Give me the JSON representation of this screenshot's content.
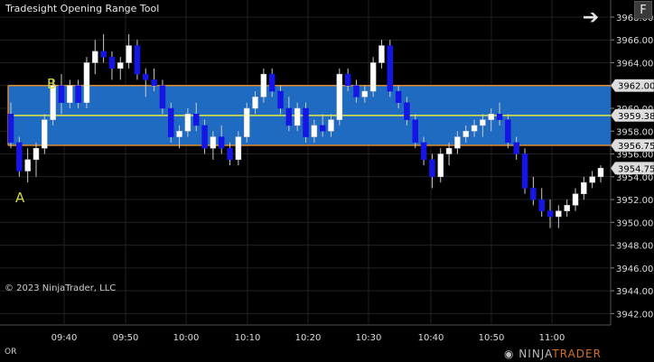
{
  "window": {
    "title": "Tradesight Opening Range Tool",
    "f_label": "F",
    "arrow_icon": "arrow-right-icon"
  },
  "labels": {
    "a": "A",
    "b": "B"
  },
  "footer": {
    "copyright": "© 2023 NinjaTrader, LLC",
    "indicator_short": "OR",
    "logo_part1": "NINJA",
    "logo_part2": "TRADER"
  },
  "colors": {
    "range_fill": "#1f6bc2",
    "range_border": "#e0892b",
    "mid_line": "#e9e93c",
    "up_candle": "#ffffff",
    "down_candle": "#1515e6",
    "grid": "#222"
  },
  "chart_data": {
    "type": "candlestick",
    "y_ticks": [
      "3968.00",
      "3966.00",
      "3964.00",
      "3962.00",
      "3960.00",
      "3958.00",
      "3956.00",
      "3954.00",
      "3952.00",
      "3950.00",
      "3948.00",
      "3946.00",
      "3944.00",
      "3942.00"
    ],
    "x_ticks": [
      "09:40",
      "09:50",
      "10:00",
      "10:10",
      "10:20",
      "10:30",
      "10:40",
      "10:50",
      "11:00"
    ],
    "opening_range": {
      "high": "3962.00",
      "low": "3956.75",
      "mid": "3959.38"
    },
    "last_price": "3954.75",
    "ylim": [
      3941.0,
      3969.5
    ],
    "candles": [
      [
        3959.5,
        3960.5,
        3956.5,
        3957.0
      ],
      [
        3957.0,
        3957.5,
        3954.0,
        3954.5
      ],
      [
        3954.5,
        3956.5,
        3953.5,
        3955.5
      ],
      [
        3955.5,
        3957.0,
        3954.0,
        3956.5
      ],
      [
        3956.5,
        3959.5,
        3956.0,
        3959.0
      ],
      [
        3959.0,
        3962.5,
        3958.5,
        3962.0
      ],
      [
        3962.0,
        3963.0,
        3959.5,
        3960.5
      ],
      [
        3960.5,
        3962.5,
        3960.0,
        3962.0
      ],
      [
        3962.0,
        3962.5,
        3960.0,
        3960.5
      ],
      [
        3960.5,
        3964.5,
        3960.0,
        3964.0
      ],
      [
        3964.0,
        3966.0,
        3963.0,
        3965.0
      ],
      [
        3965.0,
        3966.5,
        3964.0,
        3964.5
      ],
      [
        3964.5,
        3965.0,
        3962.5,
        3963.5
      ],
      [
        3963.5,
        3964.5,
        3962.5,
        3964.0
      ],
      [
        3964.0,
        3966.5,
        3963.5,
        3965.5
      ],
      [
        3965.5,
        3966.0,
        3962.5,
        3963.0
      ],
      [
        3963.0,
        3963.5,
        3961.0,
        3962.5
      ],
      [
        3962.5,
        3963.5,
        3961.5,
        3962.0
      ],
      [
        3962.0,
        3962.5,
        3959.5,
        3960.0
      ],
      [
        3960.0,
        3960.5,
        3957.0,
        3957.5
      ],
      [
        3957.5,
        3958.5,
        3956.5,
        3958.0
      ],
      [
        3958.0,
        3960.0,
        3957.5,
        3959.5
      ],
      [
        3959.5,
        3960.5,
        3958.0,
        3958.5
      ],
      [
        3958.5,
        3959.0,
        3956.0,
        3956.5
      ],
      [
        3956.5,
        3958.0,
        3955.5,
        3957.5
      ],
      [
        3957.5,
        3958.5,
        3956.0,
        3956.5
      ],
      [
        3956.5,
        3957.0,
        3955.0,
        3955.5
      ],
      [
        3955.5,
        3958.0,
        3955.0,
        3957.5
      ],
      [
        3957.5,
        3960.5,
        3957.0,
        3960.0
      ],
      [
        3960.0,
        3961.5,
        3959.5,
        3961.0
      ],
      [
        3961.0,
        3963.5,
        3960.5,
        3963.0
      ],
      [
        3963.0,
        3963.5,
        3961.0,
        3961.5
      ],
      [
        3961.5,
        3962.0,
        3959.5,
        3960.0
      ],
      [
        3960.0,
        3961.0,
        3958.0,
        3958.5
      ],
      [
        3958.5,
        3960.5,
        3958.0,
        3960.0
      ],
      [
        3960.0,
        3960.5,
        3957.0,
        3957.5
      ],
      [
        3957.5,
        3959.0,
        3957.0,
        3958.5
      ],
      [
        3958.5,
        3959.5,
        3957.5,
        3958.0
      ],
      [
        3958.0,
        3959.5,
        3957.5,
        3959.0
      ],
      [
        3959.0,
        3963.5,
        3958.5,
        3963.0
      ],
      [
        3963.0,
        3963.5,
        3961.5,
        3962.0
      ],
      [
        3962.0,
        3962.5,
        3960.5,
        3961.0
      ],
      [
        3961.0,
        3962.0,
        3960.5,
        3961.5
      ],
      [
        3961.5,
        3964.5,
        3961.0,
        3964.0
      ],
      [
        3964.0,
        3966.0,
        3963.5,
        3965.5
      ],
      [
        3965.5,
        3966.0,
        3961.0,
        3961.5
      ],
      [
        3961.5,
        3962.0,
        3960.0,
        3960.5
      ],
      [
        3960.5,
        3961.0,
        3958.5,
        3959.0
      ],
      [
        3959.0,
        3959.5,
        3956.5,
        3957.0
      ],
      [
        3957.0,
        3957.5,
        3955.0,
        3955.5
      ],
      [
        3955.5,
        3956.0,
        3953.0,
        3954.0
      ],
      [
        3954.0,
        3956.5,
        3953.5,
        3956.0
      ],
      [
        3956.0,
        3957.0,
        3955.0,
        3956.5
      ],
      [
        3956.5,
        3958.0,
        3956.0,
        3957.5
      ],
      [
        3957.5,
        3958.5,
        3957.0,
        3958.0
      ],
      [
        3958.0,
        3959.0,
        3957.5,
        3958.5
      ],
      [
        3958.5,
        3959.5,
        3957.5,
        3959.0
      ],
      [
        3959.0,
        3960.0,
        3958.0,
        3959.5
      ],
      [
        3959.5,
        3960.5,
        3958.5,
        3959.0
      ],
      [
        3959.0,
        3959.5,
        3956.5,
        3957.0
      ],
      [
        3957.0,
        3957.5,
        3955.5,
        3956.0
      ],
      [
        3956.0,
        3956.5,
        3952.5,
        3953.0
      ],
      [
        3953.0,
        3954.0,
        3951.5,
        3952.0
      ],
      [
        3952.0,
        3953.0,
        3950.5,
        3951.0
      ],
      [
        3951.0,
        3952.0,
        3949.5,
        3950.5
      ],
      [
        3950.5,
        3951.5,
        3949.5,
        3951.0
      ],
      [
        3951.0,
        3952.0,
        3950.5,
        3951.5
      ],
      [
        3951.5,
        3953.0,
        3951.0,
        3952.5
      ],
      [
        3952.5,
        3954.0,
        3952.0,
        3953.5
      ],
      [
        3953.5,
        3954.5,
        3953.0,
        3954.0
      ],
      [
        3954.0,
        3955.0,
        3953.5,
        3954.75
      ]
    ]
  }
}
